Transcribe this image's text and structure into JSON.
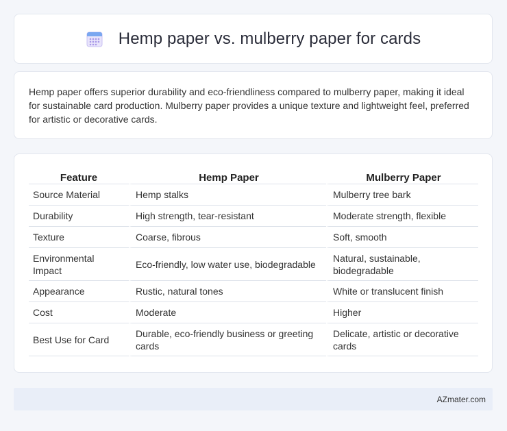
{
  "header": {
    "title": "Hemp paper vs. mulberry paper for cards",
    "icon": "calendar-icon"
  },
  "summary": {
    "text": "Hemp paper offers superior durability and eco-friendliness compared to mulberry paper, making it ideal for sustainable card production. Mulberry paper provides a unique texture and lightweight feel, preferred for artistic or decorative cards."
  },
  "table": {
    "headers": [
      "Feature",
      "Hemp Paper",
      "Mulberry Paper"
    ],
    "rows": [
      [
        "Source Material",
        "Hemp stalks",
        "Mulberry tree bark"
      ],
      [
        "Durability",
        "High strength, tear-resistant",
        "Moderate strength, flexible"
      ],
      [
        "Texture",
        "Coarse, fibrous",
        "Soft, smooth"
      ],
      [
        "Environmental Impact",
        "Eco-friendly, low water use, biodegradable",
        "Natural, sustainable, biodegradable"
      ],
      [
        "Appearance",
        "Rustic, natural tones",
        "White or translucent finish"
      ],
      [
        "Cost",
        "Moderate",
        "Higher"
      ],
      [
        "Best Use for Card",
        "Durable, eco-friendly business or greeting cards",
        "Delicate, artistic or decorative cards"
      ]
    ]
  },
  "footer": {
    "brand": "AZmater.com"
  }
}
